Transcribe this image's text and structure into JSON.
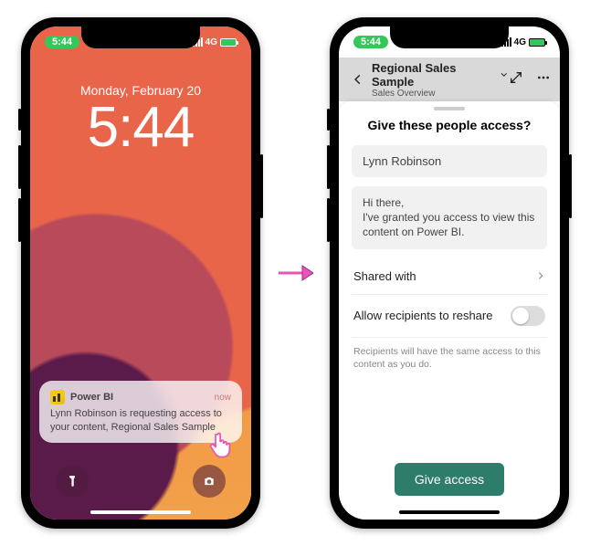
{
  "status": {
    "time_pill": "5:44",
    "network_label": "4G"
  },
  "lock": {
    "date": "Monday, February 20",
    "time": "5:44"
  },
  "notification": {
    "app_name": "Power BI",
    "when": "now",
    "body": "Lynn Robinson is requesting access to your content, Regional Sales Sample"
  },
  "app": {
    "header_title": "Regional Sales Sample",
    "header_subtitle": "Sales Overview"
  },
  "sheet": {
    "title": "Give these people access?",
    "recipient": "Lynn Robinson",
    "message": "Hi there,\nI've granted you access to view this content on Power BI.",
    "shared_with_label": "Shared with",
    "reshare_label": "Allow recipients to reshare",
    "reshare_on": false,
    "hint": "Recipients will have the same access to this content as you do.",
    "cta": "Give access"
  }
}
